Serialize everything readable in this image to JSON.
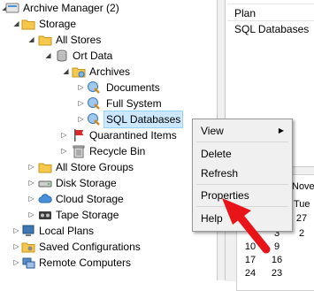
{
  "tree": {
    "root": "Archive Manager (2)",
    "storage": "Storage",
    "all_stores": "All Stores",
    "ort_data": "Ort Data",
    "archives": "Archives",
    "documents": "Documents",
    "full_system": "Full System",
    "sql_databases": "SQL Databases",
    "quarantined": "Quarantined Items",
    "recycle_bin": "Recycle Bin",
    "all_store_groups": "All Store Groups",
    "disk_storage": "Disk Storage",
    "cloud_storage": "Cloud Storage",
    "tape_storage": "Tape Storage",
    "local_plans": "Local Plans",
    "saved_configurations": "Saved Configurations",
    "remote_computers": "Remote Computers"
  },
  "list": {
    "header": "Plan",
    "row": "SQL Databases"
  },
  "calendar": {
    "month_fragment": "Nove",
    "dow_fragment": "Tue",
    "numbers": [
      "27",
      "3",
      "10",
      "17",
      "24",
      "2",
      "9",
      "16",
      "23"
    ]
  },
  "context_menu": {
    "view": "View",
    "delete": "Delete",
    "refresh": "Refresh",
    "properties": "Properties",
    "help": "Help"
  },
  "colors": {
    "selection": "#cce8ff",
    "pointer_arrow": "#e8141a"
  }
}
